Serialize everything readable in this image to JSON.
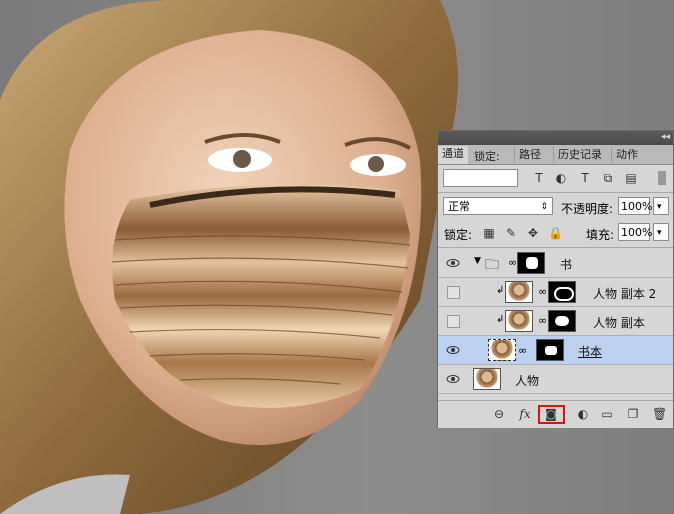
{
  "panel": {
    "tabs": [
      "通道",
      "路径",
      "历史记录",
      "动作"
    ],
    "tab_overlap_label": "锁定:",
    "blend_mode": "正常",
    "opacity_label": "不透明度:",
    "opacity_value": "100%",
    "lock_label": "锁定:",
    "fill_label": "填充:",
    "fill_value": "100%",
    "layers": [
      {
        "name": "书",
        "type": "group"
      },
      {
        "name": "人物 副本 2",
        "type": "clipped"
      },
      {
        "name": "人物 副本",
        "type": "clipped"
      },
      {
        "name": "书本",
        "type": "smart",
        "selected": true
      },
      {
        "name": "人物",
        "type": "normal"
      }
    ]
  },
  "colors": {
    "highlight": "#e01010",
    "selected_layer": "#bcd0ef"
  }
}
